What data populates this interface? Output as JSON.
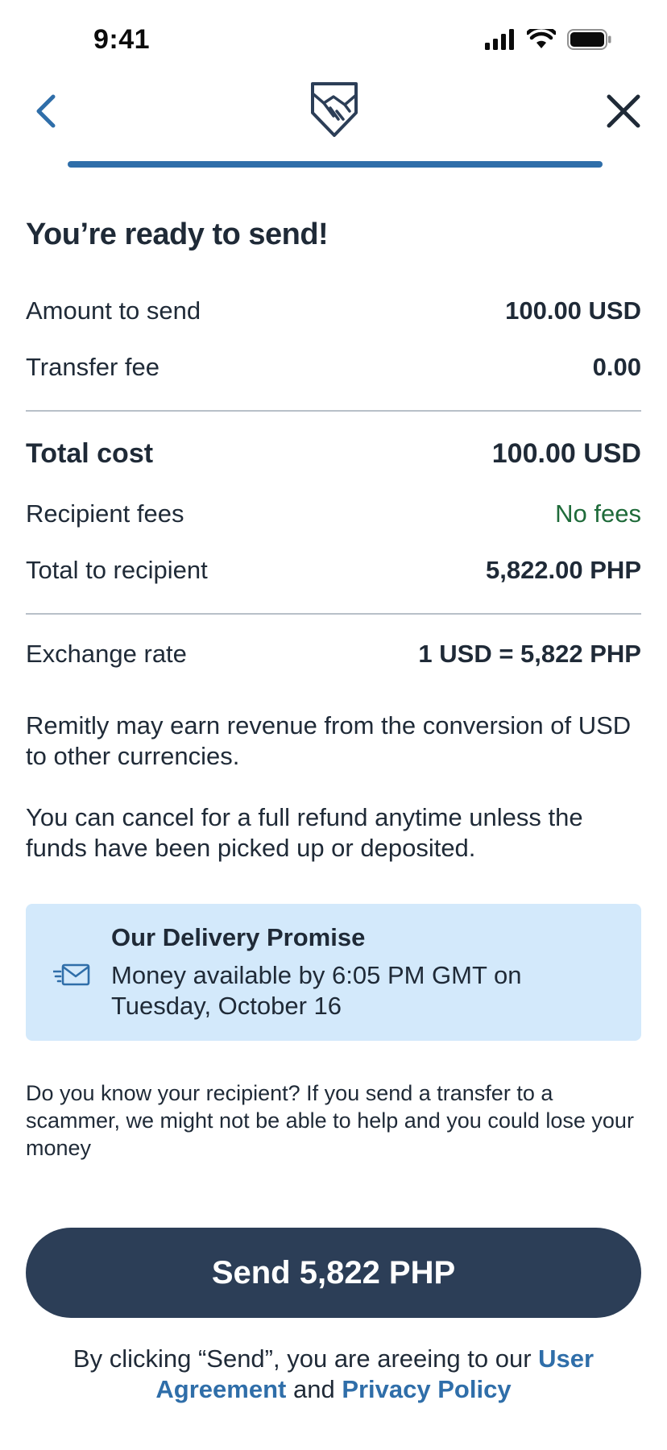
{
  "status_bar": {
    "time": "9:41",
    "icons": [
      "signal-icon",
      "wifi-icon",
      "battery-icon"
    ]
  },
  "header": {
    "back_icon": "chevron-left-icon",
    "logo_icon": "handshake-shield-icon",
    "close_icon": "close-icon",
    "progress": 1.0
  },
  "title": "You’re ready to send!",
  "summary": {
    "amount_to_send": {
      "label": "Amount to send",
      "value": "100.00 USD"
    },
    "transfer_fee": {
      "label": "Transfer fee",
      "value": "0.00"
    },
    "total_cost": {
      "label": "Total cost",
      "value": "100.00 USD"
    },
    "recipient_fees": {
      "label": "Recipient fees",
      "value": "No fees"
    },
    "total_to_recipient": {
      "label": "Total to recipient",
      "value": "5,822.00 PHP"
    },
    "exchange_rate": {
      "label": "Exchange rate",
      "value": "1 USD = 5,822 PHP"
    }
  },
  "notes": {
    "revenue": "Remitly may earn revenue from the conversion of USD to other currencies.",
    "cancel": "You can cancel for a full refund anytime unless the funds have been picked up or deposited."
  },
  "delivery_promise": {
    "icon": "envelope-fast-icon",
    "title": "Our Delivery Promise",
    "body": "Money available by 6:05 PM GMT on Tuesday, October 16"
  },
  "warning": "Do you know your recipient? If you send a transfer to a scammer, we might not be able to help and you could lose your money",
  "send_button": "Send 5,822 PHP",
  "legal": {
    "prefix": "By clicking “Send”, you are areeing to our ",
    "user_agreement": "User Agreement",
    "and": " and ",
    "privacy_policy": "Privacy Policy"
  },
  "colors": {
    "accent": "#2f6ea9",
    "button": "#2c3e57",
    "promise_bg": "#d3e9fb",
    "green": "#1f6b3a"
  }
}
